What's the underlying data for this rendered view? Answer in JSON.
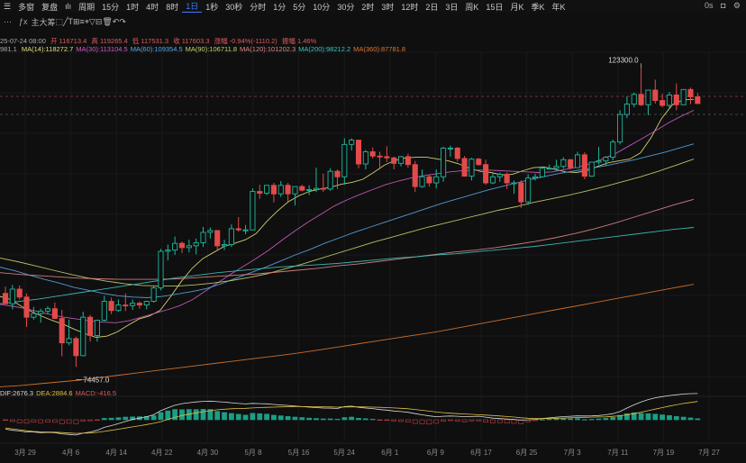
{
  "toolbar": {
    "row1": [
      "多窗",
      "复盘"
    ],
    "row2_left": [
      "周期",
      "15分",
      "1时",
      "4时",
      "8时",
      "1日",
      "1秒",
      "30秒",
      "分时",
      "1分",
      "5分",
      "10分",
      "30分",
      "2时",
      "3时",
      "12时",
      "2日",
      "3日",
      "周K",
      "15日",
      "月K",
      "季K",
      "年K"
    ],
    "active_period": "1日",
    "indicators": [
      "主",
      "大",
      "筹"
    ],
    "right": [
      "0s"
    ]
  },
  "info": {
    "line1": [
      "25-07-24 08:00",
      "开 116713.4",
      "高 119265.4",
      "低 117531.3",
      "收 117603.3",
      "涨幅 -0.94%(-1110.2)",
      "振幅 1.46%"
    ],
    "ma_prefix": "981.1",
    "mas": [
      {
        "label": "MA(14):118272.7",
        "color": "#e6e27a"
      },
      {
        "label": "MA(30):113104.5",
        "color": "#d05ec2"
      },
      {
        "label": "MA(60):109354.5",
        "color": "#5aa9e6"
      },
      {
        "label": "MA(90):106711.8",
        "color": "#c9d46b"
      },
      {
        "label": "MA(120):101202.3",
        "color": "#e08a8a"
      },
      {
        "label": "MA(200):98212.2",
        "color": "#3fc6c0"
      },
      {
        "label": "MA(360):87781.8",
        "color": "#e07a2e"
      }
    ],
    "macd": [
      {
        "label": "DIF:2676.3",
        "color": "#d9d9d9"
      },
      {
        "label": "DEA:2884.6",
        "color": "#e0c040"
      },
      {
        "label": "MACD:-416.5",
        "color": "#e05a5a"
      }
    ]
  },
  "chart_data": {
    "type": "candlestick",
    "x_ticks": [
      "3月 29",
      "4月 6",
      "4月 14",
      "4月 22",
      "4月 30",
      "5月 8",
      "5月 16",
      "5月 24",
      "6月 1",
      "6月 9",
      "6月 17",
      "6月 25",
      "7月 3",
      "7月 11",
      "7月 19",
      "7月 27"
    ],
    "y_range": [
      72000,
      126000
    ],
    "annotations": [
      {
        "label": "123300.0",
        "value": 123300
      },
      {
        "label": "74457.0",
        "value": 74457
      }
    ],
    "colors": {
      "up": "#1fb89a",
      "down": "#e34a4a"
    },
    "ohlc": [
      [
        86500,
        87600,
        85100,
        84800
      ],
      [
        84800,
        87900,
        83900,
        87200
      ],
      [
        87200,
        87800,
        85500,
        85900
      ],
      [
        85900,
        86500,
        81000,
        82600
      ],
      [
        82600,
        84300,
        82200,
        83200
      ],
      [
        83200,
        84000,
        81700,
        83600
      ],
      [
        83600,
        84400,
        83100,
        84000
      ],
      [
        84000,
        85000,
        82300,
        82400
      ],
      [
        82400,
        83800,
        76200,
        78400
      ],
      [
        78400,
        82200,
        78000,
        79100
      ],
      [
        79100,
        79400,
        74457,
        76300
      ],
      [
        76300,
        83500,
        76200,
        82600
      ],
      [
        82600,
        83000,
        78600,
        79600
      ],
      [
        79600,
        82200,
        78600,
        82100
      ],
      [
        82100,
        86100,
        81900,
        85200
      ],
      [
        85200,
        85800,
        83100,
        83700
      ],
      [
        83700,
        85500,
        83500,
        84600
      ],
      [
        84600,
        86500,
        83600,
        84500
      ],
      [
        84500,
        85500,
        83800,
        84900
      ],
      [
        84900,
        85200,
        84000,
        84600
      ],
      [
        84600,
        85300,
        83900,
        85200
      ],
      [
        85200,
        87700,
        85000,
        87400
      ],
      [
        87400,
        93800,
        87000,
        93400
      ],
      [
        93400,
        94500,
        91900,
        93600
      ],
      [
        93600,
        95800,
        92800,
        94700
      ],
      [
        94700,
        95000,
        93100,
        94000
      ],
      [
        94000,
        95300,
        93200,
        94300
      ],
      [
        94300,
        95500,
        92900,
        94800
      ],
      [
        94800,
        97400,
        94100,
        96500
      ],
      [
        96500,
        97300,
        95500,
        96800
      ],
      [
        96800,
        96800,
        93400,
        94300
      ],
      [
        94300,
        95300,
        93600,
        94500
      ],
      [
        94500,
        97800,
        94100,
        97100
      ],
      [
        97100,
        99000,
        96600,
        96900
      ],
      [
        96900,
        97700,
        96200,
        96900
      ],
      [
        96900,
        103700,
        96900,
        103200
      ],
      [
        103200,
        104300,
        102000,
        102900
      ],
      [
        102900,
        104200,
        102600,
        104200
      ],
      [
        104200,
        104600,
        101400,
        102800
      ],
      [
        102800,
        104900,
        102300,
        104200
      ],
      [
        104200,
        104600,
        101500,
        102800
      ],
      [
        102800,
        104000,
        100900,
        104000
      ],
      [
        104000,
        104300,
        103200,
        103400
      ],
      [
        103400,
        104200,
        102600,
        103500
      ],
      [
        103500,
        107100,
        103100,
        103700
      ],
      [
        103700,
        106100,
        103100,
        103600
      ],
      [
        103600,
        107000,
        103300,
        106500
      ],
      [
        106500,
        106800,
        103600,
        105600
      ],
      [
        105600,
        111900,
        104300,
        110900
      ],
      [
        110900,
        111900,
        109900,
        111600
      ],
      [
        111600,
        111600,
        107000,
        107700
      ],
      [
        107700,
        110000,
        106800,
        109700
      ],
      [
        109700,
        110400,
        108600,
        109000
      ],
      [
        109000,
        109700,
        106800,
        108900
      ],
      [
        108900,
        110600,
        108000,
        108700
      ],
      [
        108700,
        108900,
        106800,
        107800
      ],
      [
        107800,
        109000,
        107300,
        108900
      ],
      [
        108900,
        109400,
        107100,
        107600
      ],
      [
        107600,
        108200,
        103100,
        104000
      ],
      [
        104000,
        106800,
        103800,
        105600
      ],
      [
        105600,
        106000,
        104000,
        104600
      ],
      [
        104600,
        106800,
        103700,
        105600
      ],
      [
        105600,
        110500,
        104800,
        110300
      ],
      [
        110300,
        110700,
        108900,
        110300
      ],
      [
        110300,
        110500,
        108100,
        108600
      ],
      [
        108600,
        109000,
        105700,
        105700
      ],
      [
        105700,
        108700,
        105000,
        108500
      ],
      [
        108500,
        108700,
        107400,
        107600
      ],
      [
        107600,
        108400,
        104300,
        104600
      ],
      [
        104600,
        106100,
        104400,
        105600
      ],
      [
        105600,
        106300,
        104800,
        106000
      ],
      [
        106000,
        106300,
        103600,
        104600
      ],
      [
        104600,
        105000,
        102800,
        104600
      ],
      [
        104600,
        105000,
        100500,
        101500
      ],
      [
        101500,
        106000,
        101000,
        105400
      ],
      [
        105400,
        106100,
        105000,
        105600
      ],
      [
        105600,
        107300,
        105500,
        107000
      ],
      [
        107000,
        107600,
        106800,
        107000
      ],
      [
        107000,
        108400,
        106600,
        107300
      ],
      [
        107300,
        108800,
        106900,
        108400
      ],
      [
        108400,
        108500,
        106800,
        107100
      ],
      [
        107100,
        109700,
        107100,
        109200
      ],
      [
        109200,
        109600,
        105200,
        105700
      ],
      [
        105700,
        108000,
        105600,
        108000
      ],
      [
        108000,
        110500,
        107600,
        108200
      ],
      [
        108200,
        109000,
        107500,
        108800
      ],
      [
        108800,
        111700,
        108300,
        111300
      ],
      [
        111300,
        116500,
        110900,
        115800
      ],
      [
        115800,
        118800,
        115200,
        117500
      ],
      [
        117500,
        119400,
        117000,
        119100
      ],
      [
        119100,
        123300,
        117200,
        117400
      ],
      [
        117400,
        119400,
        115700,
        119800
      ],
      [
        119800,
        121500,
        117600,
        118100
      ],
      [
        118100,
        119200,
        117000,
        117300
      ],
      [
        117300,
        119500,
        116900,
        119000
      ],
      [
        119000,
        120900,
        116500,
        117400
      ],
      [
        117400,
        119700,
        117400,
        119900
      ],
      [
        119900,
        120200,
        117500,
        118700
      ],
      [
        118700,
        119300,
        117500,
        117600
      ]
    ],
    "macd_hist": [
      -50,
      -150,
      -270,
      -290,
      -200,
      -250,
      -210,
      -220,
      -340,
      -300,
      -330,
      -120,
      -90,
      -30,
      120,
      140,
      180,
      230,
      250,
      260,
      280,
      350,
      620,
      760,
      880,
      860,
      880,
      870,
      900,
      880,
      720,
      620,
      540,
      470,
      400,
      550,
      520,
      480,
      390,
      340,
      280,
      230,
      190,
      140,
      110,
      80,
      80,
      50,
      190,
      230,
      130,
      90,
      50,
      -40,
      -60,
      -100,
      -150,
      -180,
      -310,
      -340,
      -370,
      -300,
      -120,
      -80,
      -100,
      -180,
      -100,
      -90,
      -210,
      -260,
      -250,
      -280,
      -300,
      -340,
      -180,
      -80,
      20,
      50,
      80,
      110,
      80,
      110,
      20,
      40,
      80,
      120,
      200,
      380,
      520,
      600,
      540,
      520,
      480,
      420,
      360,
      280,
      230,
      160,
      90
    ],
    "dif": [
      -800,
      -900,
      -950,
      -1050,
      -1050,
      -1100,
      -1080,
      -1100,
      -1200,
      -1250,
      -1300,
      -1150,
      -1050,
      -900,
      -650,
      -500,
      -330,
      -150,
      20,
      150,
      260,
      430,
      780,
      1020,
      1240,
      1380,
      1450,
      1520,
      1570,
      1590,
      1550,
      1510,
      1450,
      1390,
      1350,
      1400,
      1380,
      1360,
      1310,
      1260,
      1220,
      1170,
      1120,
      1080,
      1040,
      1000,
      990,
      960,
      1120,
      1160,
      1060,
      1000,
      950,
      870,
      820,
      750,
      700,
      640,
      520,
      420,
      330,
      260,
      300,
      320,
      300,
      260,
      280,
      300,
      220,
      140,
      100,
      60,
      20,
      -30,
      -10,
      30,
      100,
      160,
      220,
      270,
      300,
      330,
      320,
      330,
      360,
      420,
      520,
      700,
      1000,
      1280,
      1520,
      1720,
      1880,
      1980,
      2070,
      2130,
      2200,
      2230,
      2240
    ],
    "dea": [
      -700,
      -780,
      -850,
      -940,
      -1000,
      -1030,
      -1050,
      -1060,
      -1090,
      -1130,
      -1160,
      -1150,
      -1130,
      -1080,
      -990,
      -900,
      -810,
      -710,
      -610,
      -510,
      -410,
      -300,
      -160,
      30,
      200,
      360,
      480,
      590,
      690,
      780,
      850,
      900,
      940,
      960,
      980,
      1010,
      1040,
      1060,
      1080,
      1100,
      1110,
      1120,
      1120,
      1120,
      1110,
      1100,
      1090,
      1080,
      1090,
      1100,
      1100,
      1090,
      1080,
      1060,
      1040,
      1010,
      980,
      940,
      880,
      810,
      740,
      660,
      610,
      560,
      520,
      490,
      460,
      430,
      400,
      360,
      320,
      280,
      230,
      170,
      130,
      110,
      100,
      110,
      130,
      150,
      170,
      190,
      210,
      220,
      240,
      250,
      290,
      340,
      420,
      520,
      640,
      780,
      910,
      1040,
      1170,
      1280,
      1390,
      1480,
      1560
    ],
    "ma_lines": [
      {
        "name": "MA(14)",
        "color": "#e6e27a",
        "values": [
          86000,
          85500,
          84400,
          83500,
          82700,
          82000,
          81400,
          80600,
          79900,
          79300,
          79500,
          80200,
          81300,
          82300,
          82800,
          83700,
          86000,
          88500,
          90600,
          92200,
          93200,
          94200,
          94700,
          95300,
          96300,
          98300,
          100000,
          101500,
          102500,
          103200,
          103600,
          103900,
          104400,
          104700,
          105200,
          106300,
          107500,
          108300,
          108700,
          108800,
          108800,
          108500,
          108200,
          107700,
          107000,
          106500,
          106300,
          105900,
          106000,
          106600,
          107100,
          107200,
          106800,
          106400,
          106300,
          106600,
          107300,
          107900,
          108200,
          108500,
          109500,
          112000,
          115200,
          117400,
          118200,
          118300
        ]
      },
      {
        "name": "MA(30)",
        "color": "#d05ec2",
        "values": [
          84700,
          84400,
          84000,
          83500,
          83000,
          82600,
          82300,
          82000,
          81800,
          81700,
          82000,
          82600,
          83200,
          83800,
          84500,
          85500,
          86900,
          88300,
          89700,
          91000,
          92300,
          93700,
          95300,
          96800,
          98200,
          99500,
          100800,
          101800,
          102700,
          103500,
          104300,
          104900,
          105400,
          105800,
          106100,
          106400,
          106600,
          106700,
          106700,
          106600,
          106500,
          106400,
          106300,
          106400,
          106800,
          107200,
          107800,
          108600,
          109500,
          110700,
          111900,
          113100,
          114400,
          115500,
          116500
        ]
      },
      {
        "name": "MA(60)",
        "color": "#5aa9e6",
        "values": [
          90800,
          90200,
          89500,
          88800,
          88200,
          87500,
          87000,
          86500,
          86100,
          85900,
          85800,
          86000,
          86400,
          86800,
          87300,
          88100,
          89000,
          89900,
          90800,
          91800,
          92800,
          93700,
          94700,
          95600,
          96500,
          97300,
          98100,
          98900,
          99700,
          100500,
          101300,
          102000,
          102700,
          103400,
          104000,
          104600,
          105200,
          105700,
          106200,
          106600,
          107000,
          107400,
          107900,
          108400,
          109000,
          109600,
          110300,
          111000
        ]
      },
      {
        "name": "MA(90)",
        "color": "#c9d46b",
        "values": [
          92300,
          91700,
          91000,
          90300,
          89600,
          89000,
          88500,
          88100,
          87800,
          87700,
          87700,
          87900,
          88200,
          88600,
          89100,
          89700,
          90500,
          91300,
          92200,
          93100,
          94000,
          94900,
          95700,
          96500,
          97300,
          98000,
          98700,
          99400,
          100100,
          100700,
          101400,
          102000,
          102600,
          103300,
          104000,
          104800,
          105600,
          106500,
          107500,
          108500
        ]
      },
      {
        "name": "MA(120)",
        "color": "#e08a8a",
        "values": [
          89900,
          89600,
          89400,
          89200,
          89000,
          88900,
          88800,
          88800,
          88800,
          88900,
          89100,
          89300,
          89500,
          89700,
          90000,
          90300,
          90600,
          91000,
          91300,
          91700,
          92100,
          92500,
          92900,
          93300,
          93600,
          94000,
          94500,
          95000,
          95600,
          96300,
          97100,
          98000,
          99000,
          100000,
          101000,
          101900
        ]
      },
      {
        "name": "MA(200)",
        "color": "#3fc6c0",
        "values": [
          84800,
          85200,
          85600,
          86100,
          86600,
          87100,
          87600,
          88100,
          88600,
          89100,
          89500,
          89900,
          90200,
          90500,
          90800,
          91000,
          91200,
          91400,
          91700,
          92000,
          92300,
          92500,
          92800,
          93000,
          93300,
          93600,
          93900,
          94200,
          94600,
          95000,
          95400,
          95800,
          96200,
          96600,
          97000,
          97300
        ]
      },
      {
        "name": "MA(360)",
        "color": "#e07a2e",
        "values": [
          71200,
          71400,
          71700,
          72000,
          72300,
          72700,
          73100,
          73500,
          73900,
          74300,
          74700,
          75100,
          75500,
          75900,
          76300,
          76700,
          77200,
          77700,
          78200,
          78700,
          79200,
          79700,
          80200,
          80800,
          81400,
          82000,
          82600,
          83200,
          83800,
          84400,
          85000,
          85600,
          86200,
          86800,
          87400,
          88000
        ]
      }
    ]
  }
}
